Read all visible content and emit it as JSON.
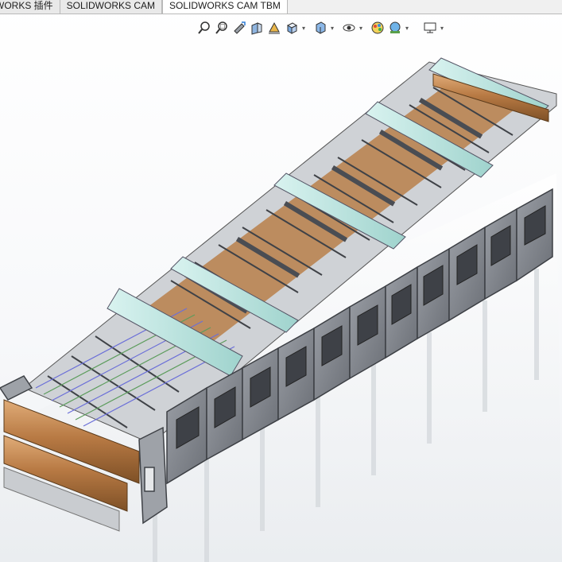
{
  "command_manager": {
    "tabs": [
      {
        "label": "WORKS 插件"
      },
      {
        "label": "SOLIDWORKS CAM"
      },
      {
        "label": "SOLIDWORKS CAM TBM"
      }
    ],
    "active_tab": "SOLIDWORKS CAM TBM"
  },
  "heads_up_toolbar": {
    "buttons": [
      {
        "icon": "zoom-to-fit-icon"
      },
      {
        "icon": "zoom-to-area-icon"
      },
      {
        "icon": "previous-view-icon"
      },
      {
        "icon": "section-view-icon"
      },
      {
        "icon": "dynamic-annotation-views-icon"
      },
      {
        "icon": "view-orientation-icon",
        "dropdown": true
      },
      {
        "icon": "display-style-icon",
        "dropdown": true
      },
      {
        "icon": "hide-show-items-icon",
        "dropdown": true
      },
      {
        "icon": "edit-appearance-icon"
      },
      {
        "icon": "apply-scene-icon",
        "dropdown": true
      },
      {
        "icon": "view-settings-icon",
        "dropdown": true
      }
    ]
  },
  "model": {
    "description": "",
    "colors": {
      "frame": "#8c9097",
      "frame_dark": "#5d6168",
      "roller": "#b57a45",
      "roller_light": "#d8a36f",
      "glass": "#bfe8e4",
      "panel_window": "#3e4147"
    }
  }
}
